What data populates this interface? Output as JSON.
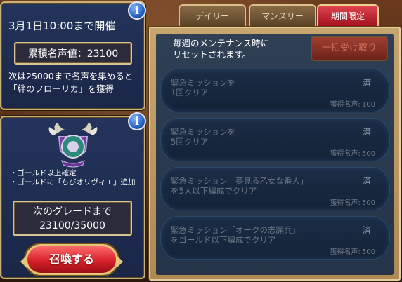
{
  "event": {
    "deadline": "3月1日10:00まで開催",
    "fame_total": "累積名声値：23100",
    "next_reward_line1": "次は25000まで名声を集めると",
    "next_reward_line2": "「絆のフローリカ」を獲得"
  },
  "grade": {
    "perk1": "・ゴールド以上確定",
    "perk2": "・ゴールドに「ちびオリヴィエ」追加",
    "next_label": "次のグレードまで",
    "progress": "23100/35000",
    "summon_button": "召喚する"
  },
  "tabs": [
    {
      "label": "デイリー",
      "active": false
    },
    {
      "label": "マンスリー",
      "active": false
    },
    {
      "label": "期間限定",
      "active": true
    }
  ],
  "reset_note_line1": "毎週のメンテナンス時に",
  "reset_note_line2": "リセットされます。",
  "claim_all_button": "一括受け取り",
  "reward_label": "獲得名声:",
  "missions": [
    {
      "title1": "緊急ミッションを",
      "title2": "1回クリア",
      "status": "済",
      "reward": "100"
    },
    {
      "title1": "緊急ミッションを",
      "title2": "5回クリア",
      "status": "済",
      "reward": "500"
    },
    {
      "title1": "緊急ミッション「夢見る乙女な番人」",
      "title2": "を5人以下編成でクリア",
      "status": "済",
      "reward": "500"
    },
    {
      "title1": "緊急ミッション「オークの志願兵」",
      "title2": "をゴールド以下編成でクリア",
      "status": "済",
      "reward": "500"
    }
  ],
  "colors": {
    "panel_blue": "#1b2647",
    "gold_border": "#c9b27a",
    "active_tab_red": "#d8202a"
  }
}
